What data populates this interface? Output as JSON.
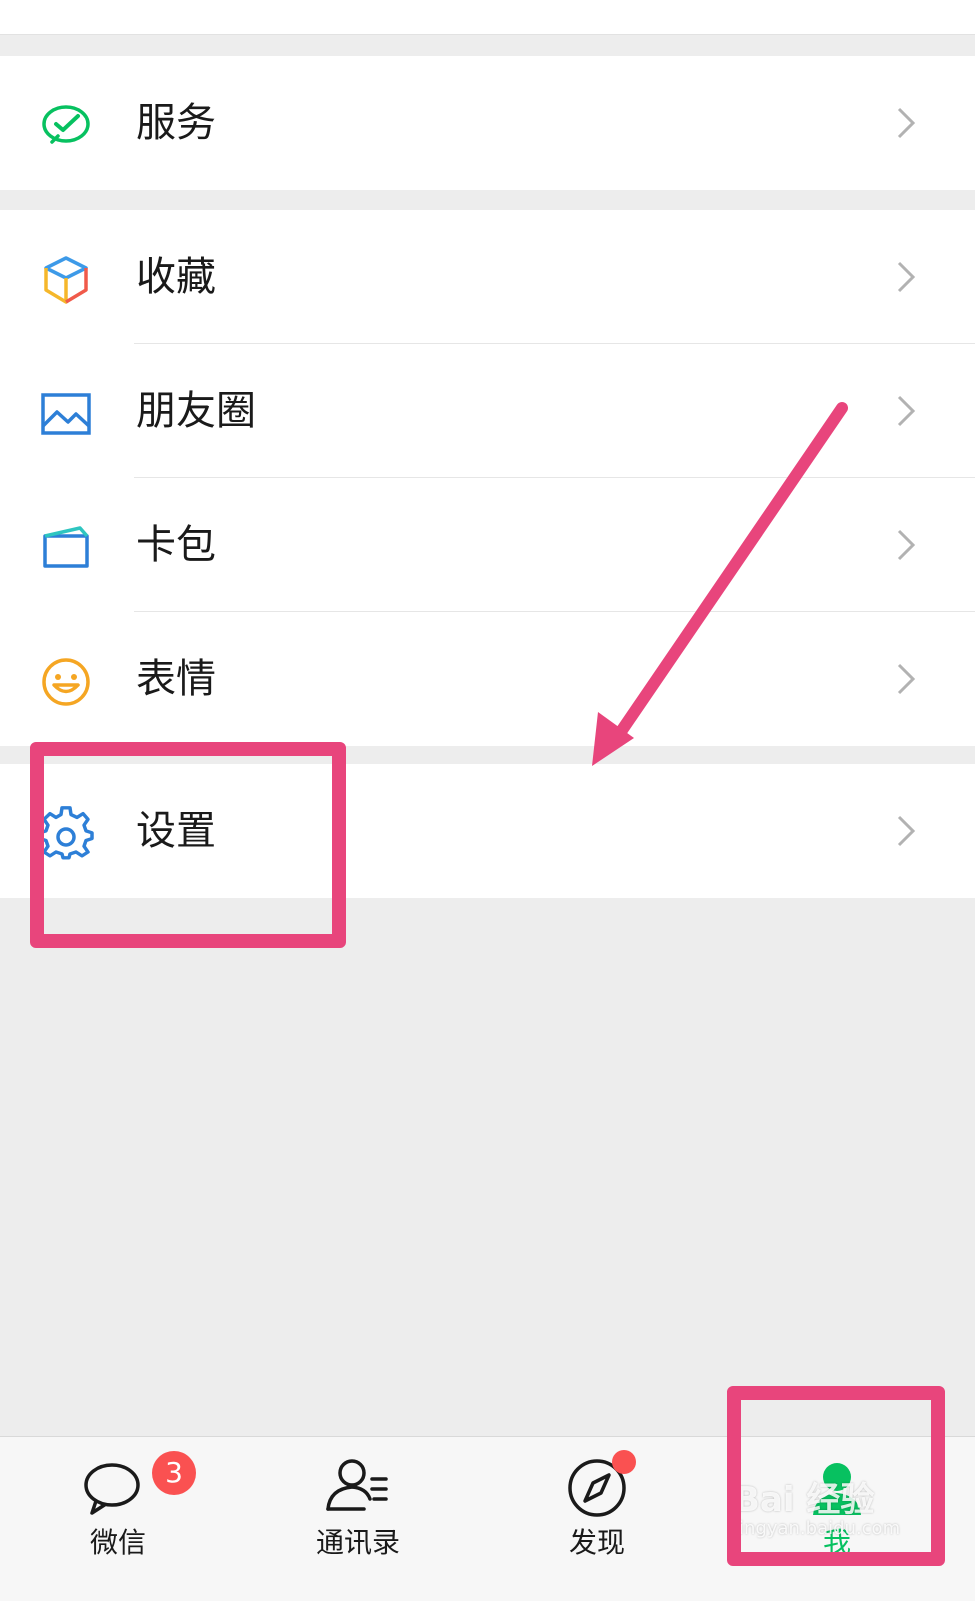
{
  "menu": {
    "service": {
      "label": "服务"
    },
    "favorites": {
      "label": "收藏"
    },
    "moments": {
      "label": "朋友圈"
    },
    "cards": {
      "label": "卡包"
    },
    "stickers": {
      "label": "表情"
    },
    "settings": {
      "label": "设置"
    }
  },
  "tabbar": {
    "chats": {
      "label": "微信",
      "badge": "3"
    },
    "contacts": {
      "label": "通讯录"
    },
    "discover": {
      "label": "发现"
    },
    "me": {
      "label": "我"
    }
  },
  "watermark": {
    "main": "Bai 经验",
    "sub": "jingyan.baidu.com"
  },
  "colors": {
    "accent": "#07c160",
    "annotation": "#e8457c",
    "badge": "#fa5151",
    "background": "#ededed"
  },
  "icons": {
    "service": "wechat-pay-check-icon",
    "favorites": "cube-icon",
    "moments": "picture-icon",
    "cards": "card-wallet-icon",
    "stickers": "smiley-icon",
    "settings": "gear-icon",
    "chevron": "chevron-right-icon"
  }
}
